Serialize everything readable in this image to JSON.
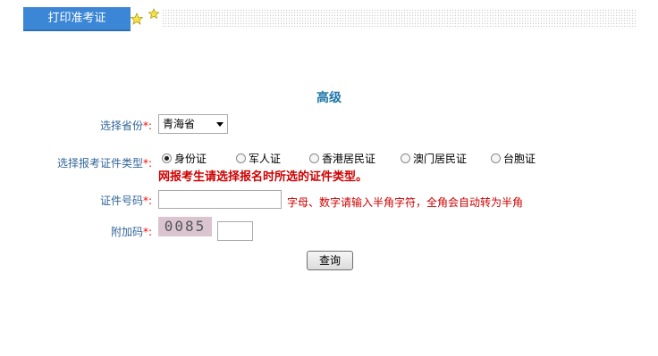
{
  "tab": {
    "label": "打印准考证"
  },
  "title": "高级",
  "province": {
    "label": "选择省份",
    "required": "*:",
    "selected": "青海省"
  },
  "id_type": {
    "label": "选择报考证件类型",
    "required": "*:",
    "options": [
      "身份证",
      "军人证",
      "香港居民证",
      "澳门居民证",
      "台胞证"
    ],
    "selected_index": 0,
    "warning": "网报考生请选择报名时所选的证件类型。"
  },
  "id_number": {
    "label": "证件号码",
    "required": "*:",
    "value": "",
    "hint": "字母、数字请输入半角字符，全角会自动转为半角"
  },
  "captcha": {
    "label": "附加码",
    "required": "*:",
    "code": "0085",
    "value": ""
  },
  "submit": {
    "label": "查询"
  },
  "colors": {
    "tab": "#3c86d6",
    "label": "#336699",
    "title": "#2277aa",
    "warn": "#cc0000"
  }
}
